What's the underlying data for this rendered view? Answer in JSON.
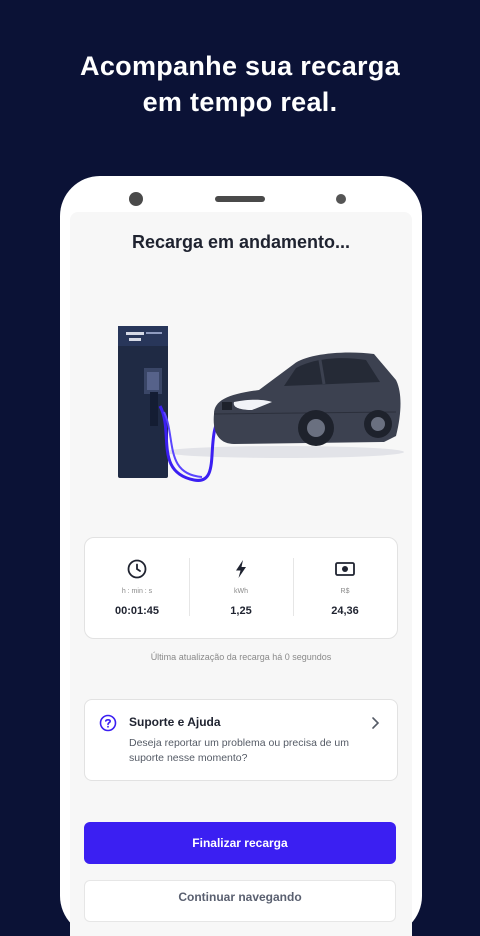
{
  "headline": {
    "line1": "Acompanhe sua recarga",
    "line2": "em tempo real."
  },
  "screen": {
    "title": "Recarga em andamento...",
    "stats": [
      {
        "icon": "clock-icon",
        "unit": "h : min : s",
        "value": "00:01:45"
      },
      {
        "icon": "lightning-icon",
        "unit": "kWh",
        "value": "1,25"
      },
      {
        "icon": "money-icon",
        "unit": "R$",
        "value": "24,36"
      }
    ],
    "last_update": "Última atualização da recarga há 0 segundos",
    "support": {
      "icon": "help-circle-icon",
      "title": "Suporte e Ajuda",
      "description": "Deseja reportar um problema ou precisa de um suporte nesse momento?"
    },
    "primary_button": "Finalizar recarga",
    "secondary_button": "Continuar navegando"
  },
  "colors": {
    "background": "#0b1236",
    "accent": "#3b1ff2"
  }
}
